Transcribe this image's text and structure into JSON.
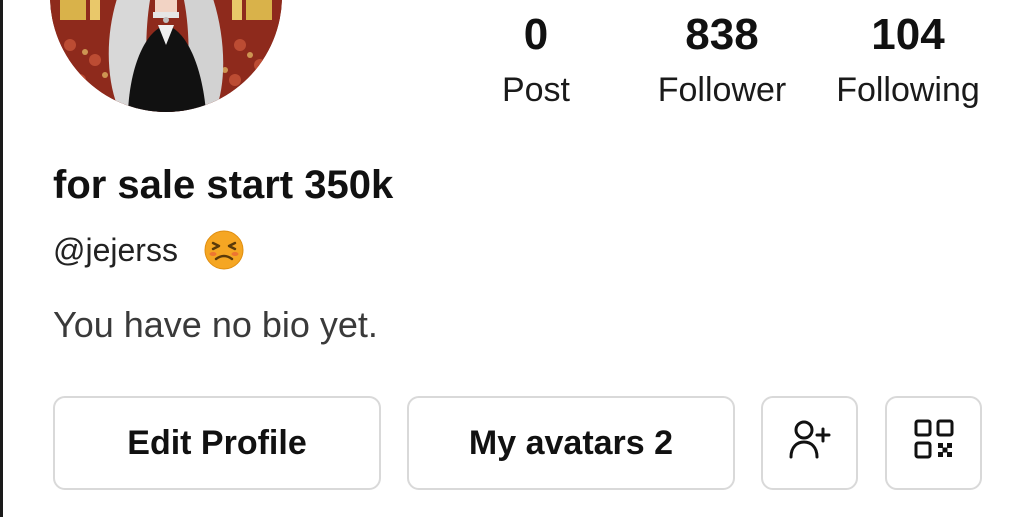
{
  "profile": {
    "display_name": "for sale start 350k",
    "handle": "@jejerss",
    "status_emoji": "tired-face-emoji",
    "bio": "You have no bio yet."
  },
  "stats": {
    "post_count": "0",
    "post_label": "Post",
    "follower_count": "838",
    "follower_label": "Follower",
    "following_count": "104",
    "following_label": "Following"
  },
  "actions": {
    "edit_profile_label": "Edit Profile",
    "my_avatars_label": "My avatars 2",
    "add_friend_icon": "add-user-icon",
    "qr_icon": "qr-code-icon"
  },
  "colors": {
    "button_border": "#d9d9d9",
    "text_primary": "#111111",
    "text_secondary": "#3a3a3a",
    "emoji_face": "#f5a623"
  }
}
